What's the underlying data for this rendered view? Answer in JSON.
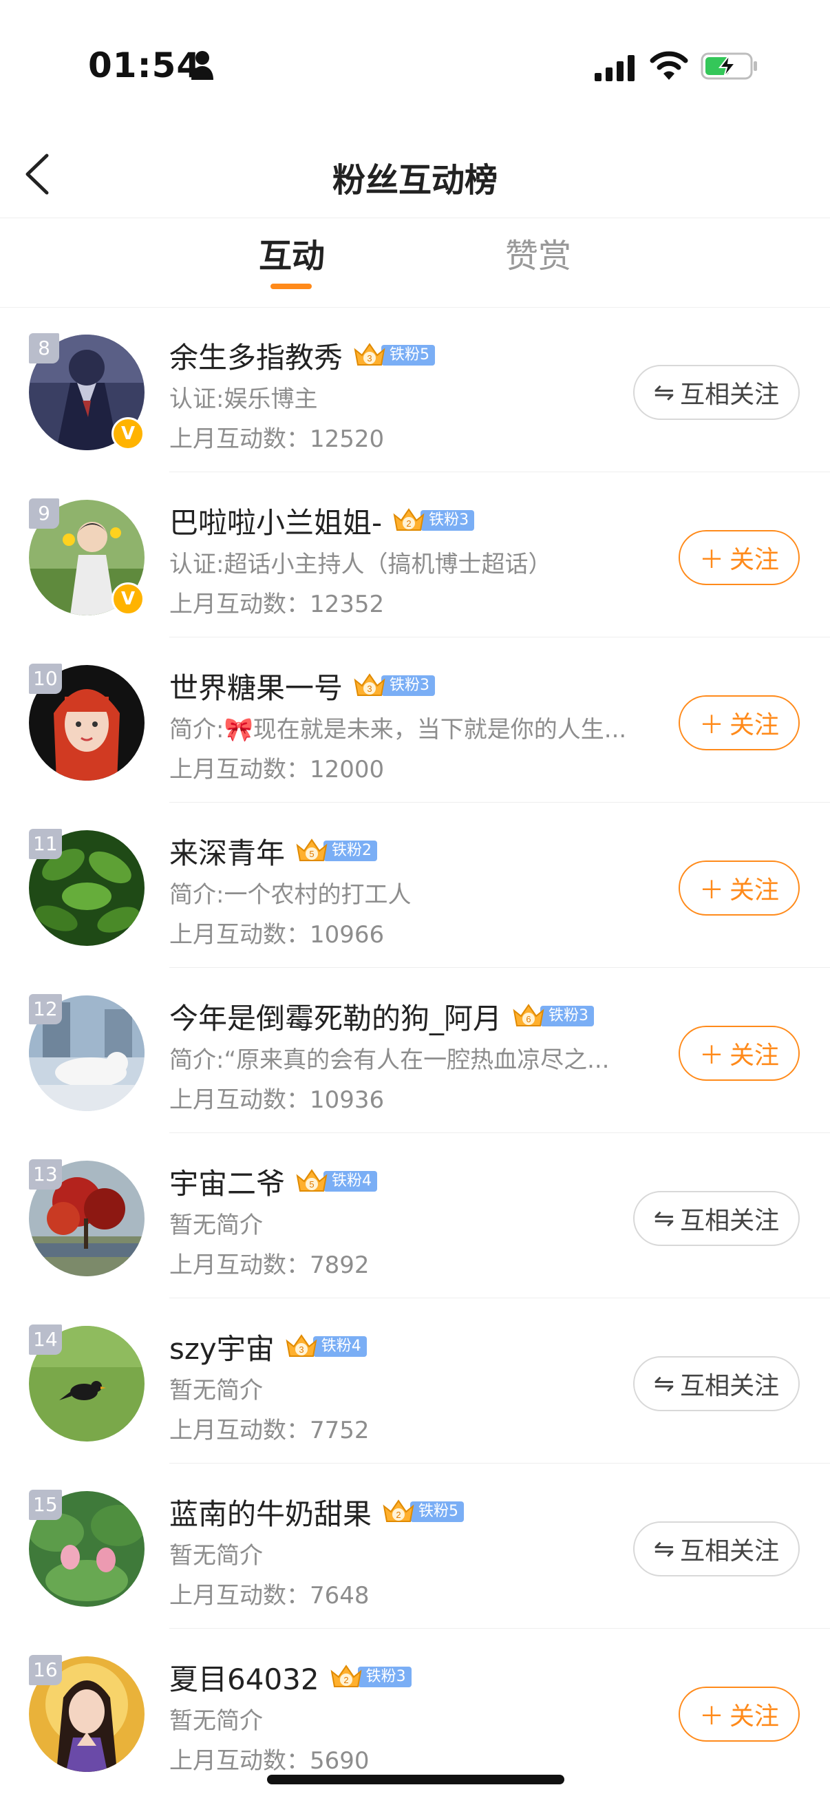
{
  "status_bar": {
    "time": "01:54"
  },
  "header": {
    "title": "粉丝互动榜"
  },
  "tabs": [
    {
      "label": "互动",
      "active": true
    },
    {
      "label": "赞赏",
      "active": false
    }
  ],
  "colors": {
    "accent": "#ff8a1a",
    "fan_badge": "#7aaef5",
    "rank_badge": "#b9bdcb",
    "verified": "#ffb300"
  },
  "rows": [
    {
      "rank": "8",
      "name": "余生多指教秀",
      "crown_level": "3",
      "fan_label": "铁粉5",
      "desc": "认证:娱乐博主",
      "count_label": "上月互动数：",
      "count": "12520",
      "verified": true,
      "button": "互相关注",
      "button_type": "mutual"
    },
    {
      "rank": "9",
      "name": "巴啦啦小兰姐姐-",
      "crown_level": "2",
      "fan_label": "铁粉3",
      "desc": "认证:超话小主持人（搞机博士超话）",
      "count_label": "上月互动数：",
      "count": "12352",
      "verified": true,
      "button": "关注",
      "button_type": "follow"
    },
    {
      "rank": "10",
      "name": "世界糖果一号",
      "crown_level": "3",
      "fan_label": "铁粉3",
      "desc": "简介:🎀现在就是未来，当下就是你的人生...",
      "count_label": "上月互动数：",
      "count": "12000",
      "verified": false,
      "button": "关注",
      "button_type": "follow"
    },
    {
      "rank": "11",
      "name": "来深青年",
      "crown_level": "5",
      "fan_label": "铁粉2",
      "desc": "简介:一个农村的打工人",
      "count_label": "上月互动数：",
      "count": "10966",
      "verified": false,
      "button": "关注",
      "button_type": "follow"
    },
    {
      "rank": "12",
      "name": "今年是倒霉死勒的狗_阿月",
      "crown_level": "6",
      "fan_label": "铁粉3",
      "desc": "简介:“原来真的会有人在一腔热血凉尽之...",
      "count_label": "上月互动数：",
      "count": "10936",
      "verified": false,
      "button": "关注",
      "button_type": "follow"
    },
    {
      "rank": "13",
      "name": "宇宙二爷",
      "crown_level": "5",
      "fan_label": "铁粉4",
      "desc": "暂无简介",
      "count_label": "上月互动数：",
      "count": "7892",
      "verified": false,
      "button": "互相关注",
      "button_type": "mutual"
    },
    {
      "rank": "14",
      "name": "szy宇宙",
      "crown_level": "3",
      "fan_label": "铁粉4",
      "desc": "暂无简介",
      "count_label": "上月互动数：",
      "count": "7752",
      "verified": false,
      "button": "互相关注",
      "button_type": "mutual"
    },
    {
      "rank": "15",
      "name": "蓝南的牛奶甜果",
      "crown_level": "2",
      "fan_label": "铁粉5",
      "desc": "暂无简介",
      "count_label": "上月互动数：",
      "count": "7648",
      "verified": false,
      "button": "互相关注",
      "button_type": "mutual"
    },
    {
      "rank": "16",
      "name": "夏目64032",
      "crown_level": "2",
      "fan_label": "铁粉3",
      "desc": "暂无简介",
      "count_label": "上月互动数：",
      "count": "5690",
      "verified": false,
      "button": "关注",
      "button_type": "follow"
    }
  ]
}
